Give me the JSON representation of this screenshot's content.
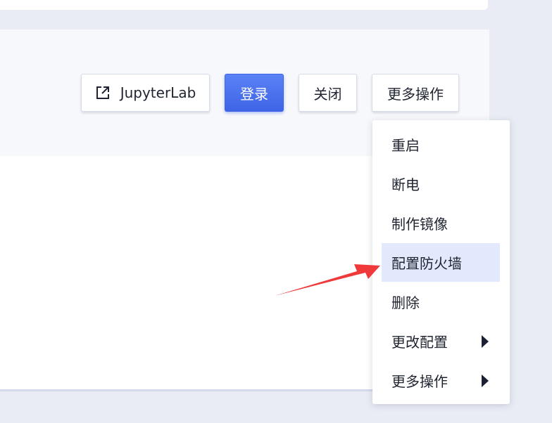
{
  "toolbar": {
    "jupyter_label": "JupyterLab",
    "login_label": "登录",
    "close_label": "关闭",
    "more_label": "更多操作"
  },
  "dropdown": {
    "items": [
      {
        "label": "重启",
        "submenu": false
      },
      {
        "label": "断电",
        "submenu": false
      },
      {
        "label": "制作镜像",
        "submenu": false
      },
      {
        "label": "配置防火墙",
        "submenu": false,
        "highlighted": true
      },
      {
        "label": "删除",
        "submenu": false
      },
      {
        "label": "更改配置",
        "submenu": true
      },
      {
        "label": "更多操作",
        "submenu": true
      }
    ]
  },
  "icons": {
    "jupyter": "external-link-icon",
    "submenu": "caret-right-icon",
    "annotation": "red-pointer-arrow"
  },
  "colors": {
    "primary": "#4a70ee",
    "highlight": "#e2e9fc",
    "annotation": "#f0393a",
    "background": "#e9ecf4"
  }
}
